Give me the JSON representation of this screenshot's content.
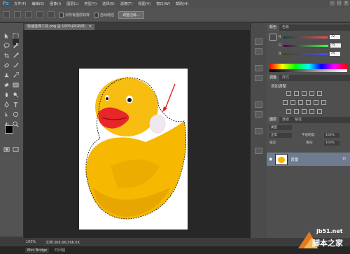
{
  "app": {
    "logo": "Ps"
  },
  "menubar": {
    "items": [
      {
        "label": "文件(F)"
      },
      {
        "label": "编辑(E)"
      },
      {
        "label": "图像(I)"
      },
      {
        "label": "图层(L)"
      },
      {
        "label": "类型(Y)"
      },
      {
        "label": "选择(S)"
      },
      {
        "label": "滤镜(T)"
      },
      {
        "label": "视图(V)"
      },
      {
        "label": "窗口(W)"
      },
      {
        "label": "帮助(H)"
      }
    ],
    "window_controls": {
      "minimize": "–",
      "maximize": "□",
      "close": "×"
    }
  },
  "options": {
    "sample_all_layers": "对所有图层取样",
    "auto_enhance": "自动增强",
    "refine_edge": "调整边缘..."
  },
  "document": {
    "tab_title": "快速选择工具.png @ 100%(RGB/8)",
    "tab_close": "×"
  },
  "status": {
    "zoom": "100%",
    "doc_info": "文档:366.6K/366.6K"
  },
  "bottombar": {
    "tab1": "Mini Bridge",
    "tab2": "时间轴"
  },
  "panels": {
    "color": {
      "tab1": "颜色",
      "tab2": "色板",
      "r_label": "R",
      "g_label": "G",
      "b_label": "B",
      "r_value": "72",
      "g_value": "75",
      "b_value": "74"
    },
    "adjustments": {
      "tab1": "调整",
      "tab2": "样式",
      "title": "添加调整"
    },
    "layers": {
      "tab1": "图层",
      "tab2": "通道",
      "tab3": "路径",
      "kind_label": "类型",
      "blend_mode": "正常",
      "opacity_label": "不透明度:",
      "opacity_value": "100%",
      "lock_label": "锁定:",
      "fill_label": "填充:",
      "fill_value": "100%",
      "layer_name": "背景"
    }
  },
  "watermark": {
    "site": "jb51.net",
    "name": "脚本之家"
  },
  "colors": {
    "ps_blue": "#31a8ff",
    "duck_yellow": "#f6b800",
    "beak_red": "#e8262a",
    "annotation_red": "#e02020",
    "layer_selected": "#6f7b8e"
  }
}
